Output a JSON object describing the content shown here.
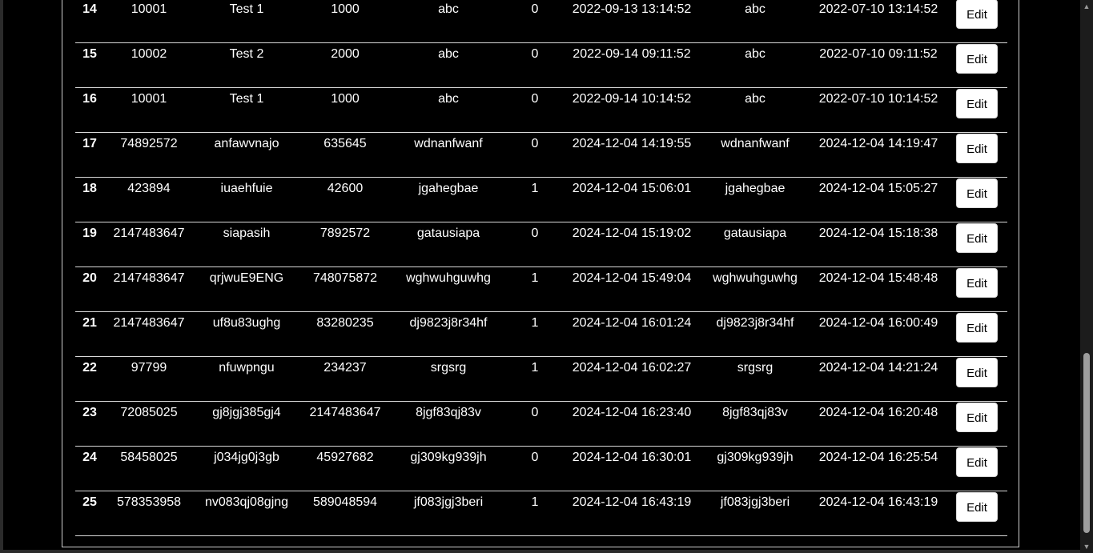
{
  "table": {
    "action_label": "Edit",
    "rows": [
      {
        "id": "14",
        "c1": "10001",
        "c2": "Test 1",
        "c3": "1000",
        "c4": "abc",
        "c5": "0",
        "c6": "2022-09-13 13:14:52",
        "c7": "abc",
        "c8": "2022-07-10 13:14:52"
      },
      {
        "id": "15",
        "c1": "10002",
        "c2": "Test 2",
        "c3": "2000",
        "c4": "abc",
        "c5": "0",
        "c6": "2022-09-14 09:11:52",
        "c7": "abc",
        "c8": "2022-07-10 09:11:52"
      },
      {
        "id": "16",
        "c1": "10001",
        "c2": "Test 1",
        "c3": "1000",
        "c4": "abc",
        "c5": "0",
        "c6": "2022-09-14 10:14:52",
        "c7": "abc",
        "c8": "2022-07-10 10:14:52"
      },
      {
        "id": "17",
        "c1": "74892572",
        "c2": "anfawvnajo",
        "c3": "635645",
        "c4": "wdnanfwanf",
        "c5": "0",
        "c6": "2024-12-04 14:19:55",
        "c7": "wdnanfwanf",
        "c8": "2024-12-04 14:19:47"
      },
      {
        "id": "18",
        "c1": "423894",
        "c2": "iuaehfuie",
        "c3": "42600",
        "c4": "jgahegbae",
        "c5": "1",
        "c6": "2024-12-04 15:06:01",
        "c7": "jgahegbae",
        "c8": "2024-12-04 15:05:27"
      },
      {
        "id": "19",
        "c1": "2147483647",
        "c2": "siapasih",
        "c3": "7892572",
        "c4": "gatausiapa",
        "c5": "0",
        "c6": "2024-12-04 15:19:02",
        "c7": "gatausiapa",
        "c8": "2024-12-04 15:18:38"
      },
      {
        "id": "20",
        "c1": "2147483647",
        "c2": "qrjwuE9ENG",
        "c3": "748075872",
        "c4": "wghwuhguwhg",
        "c5": "1",
        "c6": "2024-12-04 15:49:04",
        "c7": "wghwuhguwhg",
        "c8": "2024-12-04 15:48:48"
      },
      {
        "id": "21",
        "c1": "2147483647",
        "c2": "uf8u83ughg",
        "c3": "83280235",
        "c4": "dj9823j8r34hf",
        "c5": "1",
        "c6": "2024-12-04 16:01:24",
        "c7": "dj9823j8r34hf",
        "c8": "2024-12-04 16:00:49"
      },
      {
        "id": "22",
        "c1": "97799",
        "c2": "nfuwpngu",
        "c3": "234237",
        "c4": "srgsrg",
        "c5": "1",
        "c6": "2024-12-04 16:02:27",
        "c7": "srgsrg",
        "c8": "2024-12-04 14:21:24"
      },
      {
        "id": "23",
        "c1": "72085025",
        "c2": "gj8jgj385gj4",
        "c3": "2147483647",
        "c4": "8jgf83qj83v",
        "c5": "0",
        "c6": "2024-12-04 16:23:40",
        "c7": "8jgf83qj83v",
        "c8": "2024-12-04 16:20:48"
      },
      {
        "id": "24",
        "c1": "58458025",
        "c2": "j034jg0j3gb",
        "c3": "45927682",
        "c4": "gj309kg939jh",
        "c5": "0",
        "c6": "2024-12-04 16:30:01",
        "c7": "gj309kg939jh",
        "c8": "2024-12-04 16:25:54"
      },
      {
        "id": "25",
        "c1": "578353958",
        "c2": "nv083qj08gjng",
        "c3": "589048594",
        "c4": "jf083jgj3beri",
        "c5": "1",
        "c6": "2024-12-04 16:43:19",
        "c7": "jf083jgj3beri",
        "c8": "2024-12-04 16:43:19"
      }
    ]
  },
  "scrollbar": {
    "up_icon": "triangle-up-icon",
    "down_icon": "triangle-down-icon",
    "position": 0.98
  }
}
